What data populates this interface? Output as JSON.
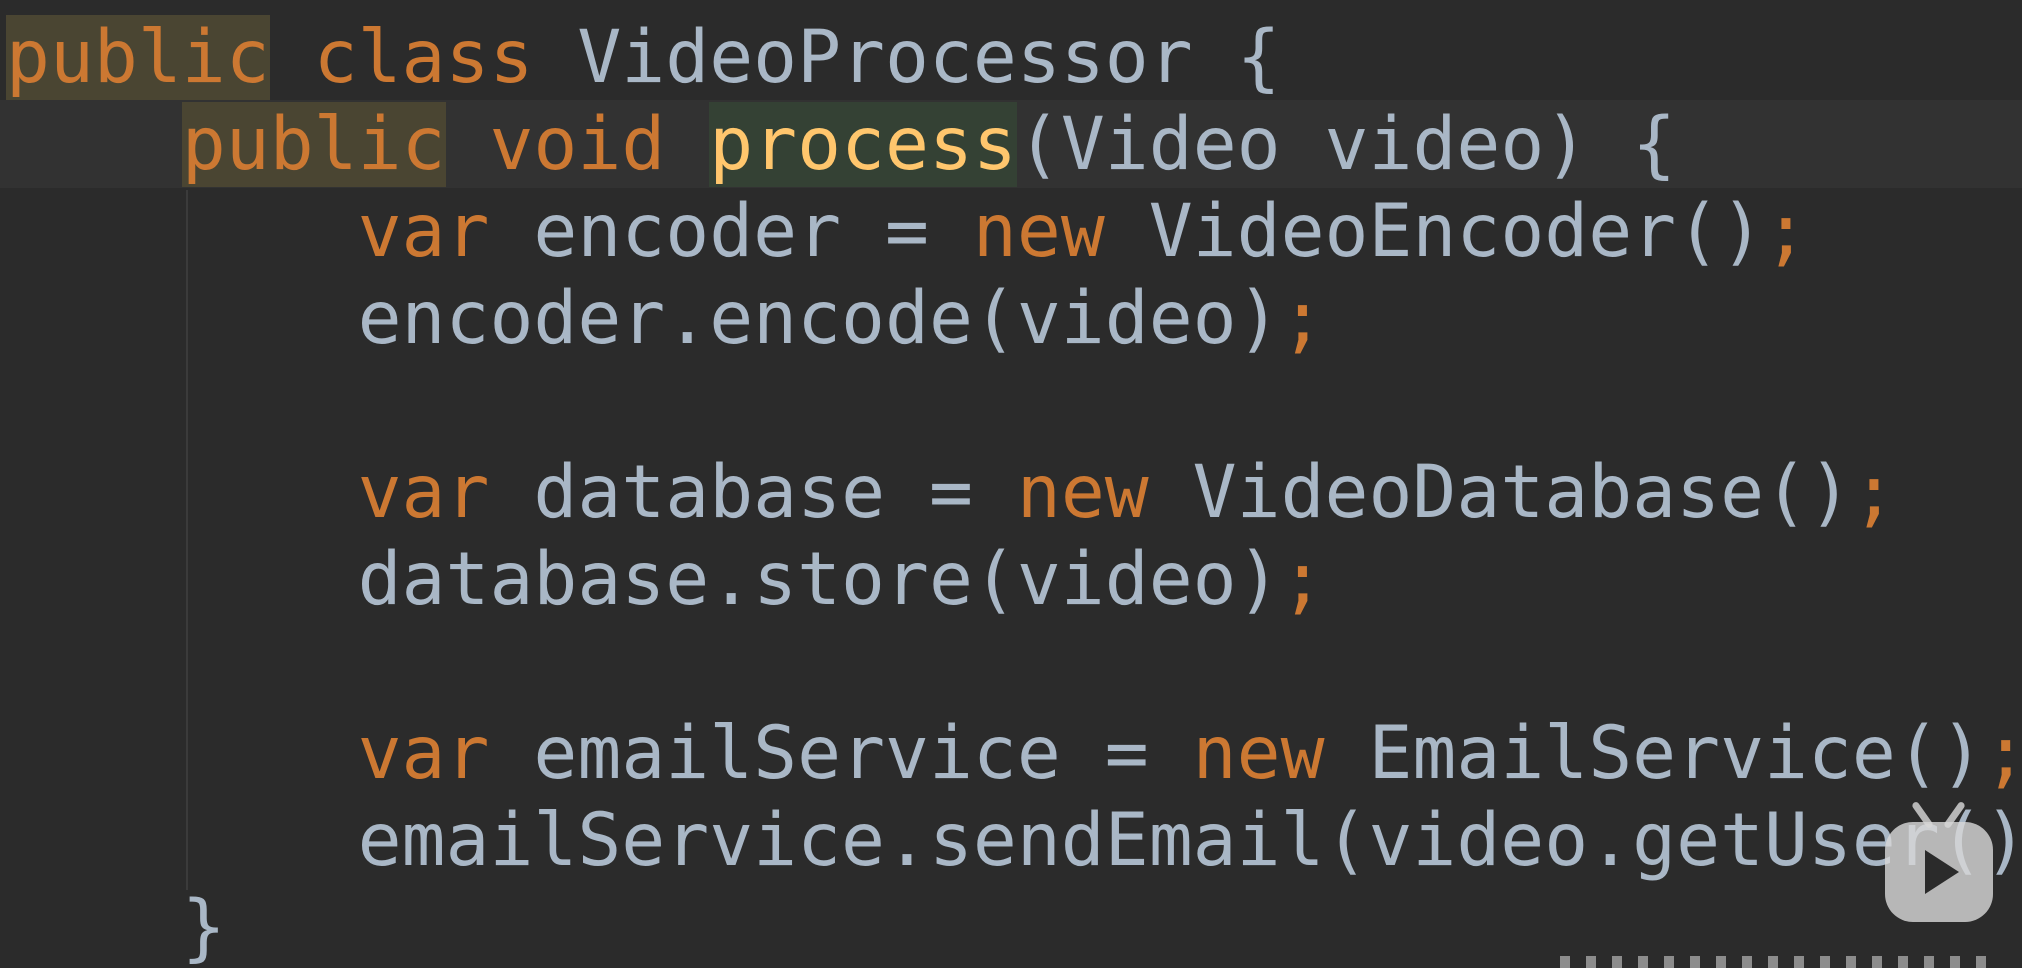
{
  "editor": {
    "theme": {
      "background": "#2b2b2b",
      "current_line": "#323232",
      "keyword": "#cc7832",
      "identifier": "#a9b7c6",
      "method_declaration": "#ffc66d"
    },
    "lines": [
      {
        "tokens": [
          {
            "text": "public",
            "type": "kw",
            "highlight": "public"
          },
          {
            "text": " ",
            "type": "plain"
          },
          {
            "text": "class",
            "type": "kw"
          },
          {
            "text": " VideoProcessor {",
            "type": "plain"
          }
        ]
      },
      {
        "current": true,
        "tokens": [
          {
            "text": "    ",
            "type": "plain"
          },
          {
            "text": "public",
            "type": "kw",
            "highlight": "public"
          },
          {
            "text": " ",
            "type": "plain"
          },
          {
            "text": "void",
            "type": "kw"
          },
          {
            "text": " ",
            "type": "plain"
          },
          {
            "text": "process",
            "type": "fn",
            "highlight": "process",
            "caret": true
          },
          {
            "text": "(Video video) {",
            "type": "plain"
          }
        ]
      },
      {
        "tokens": [
          {
            "text": "        ",
            "type": "plain"
          },
          {
            "text": "var",
            "type": "kw"
          },
          {
            "text": " encoder = ",
            "type": "plain"
          },
          {
            "text": "new",
            "type": "kw"
          },
          {
            "text": " VideoEncoder()",
            "type": "plain"
          },
          {
            "text": ";",
            "type": "punc"
          }
        ]
      },
      {
        "tokens": [
          {
            "text": "        encoder.encode(video)",
            "type": "plain"
          },
          {
            "text": ";",
            "type": "punc"
          }
        ]
      },
      {
        "tokens": []
      },
      {
        "tokens": [
          {
            "text": "        ",
            "type": "plain"
          },
          {
            "text": "var",
            "type": "kw"
          },
          {
            "text": " database = ",
            "type": "plain"
          },
          {
            "text": "new",
            "type": "kw"
          },
          {
            "text": " VideoDatabase()",
            "type": "plain"
          },
          {
            "text": ";",
            "type": "punc"
          }
        ]
      },
      {
        "tokens": [
          {
            "text": "        database.store(video)",
            "type": "plain"
          },
          {
            "text": ";",
            "type": "punc"
          }
        ]
      },
      {
        "tokens": []
      },
      {
        "tokens": [
          {
            "text": "        ",
            "type": "plain"
          },
          {
            "text": "var",
            "type": "kw"
          },
          {
            "text": " emailService = ",
            "type": "plain"
          },
          {
            "text": "new",
            "type": "kw"
          },
          {
            "text": " EmailService()",
            "type": "plain"
          },
          {
            "text": ";",
            "type": "punc"
          }
        ]
      },
      {
        "tokens": [
          {
            "text": "        emailService.sendEmail(video.getUser()",
            "type": "plain"
          }
        ]
      },
      {
        "tokens": [
          {
            "text": "    }",
            "type": "plain"
          }
        ]
      }
    ]
  },
  "overlay": {
    "play_button_icon": "video-play-icon"
  }
}
